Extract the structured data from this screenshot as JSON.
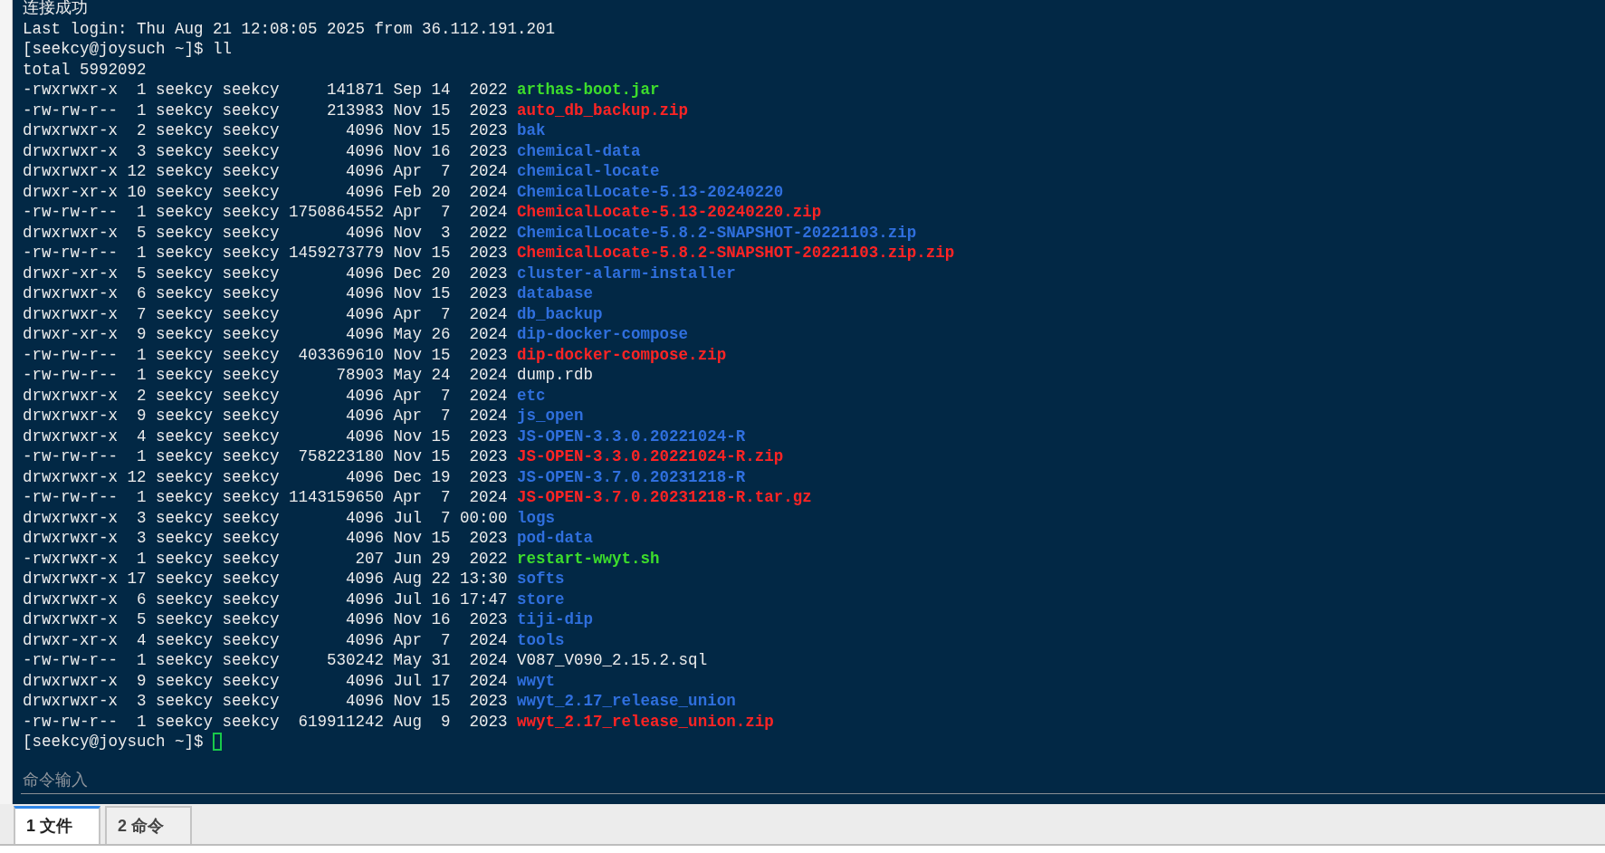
{
  "terminal": {
    "lines": [
      {
        "kind": "text",
        "text": "连接成功"
      },
      {
        "kind": "text",
        "text": "Last login: Thu Aug 21 12:08:05 2025 from 36.112.191.201"
      },
      {
        "kind": "text",
        "text": "[seekcy@joysuch ~]$ ll"
      },
      {
        "kind": "text",
        "text": "total 5992092"
      },
      {
        "kind": "entry",
        "info": "-rwxrwxr-x  1 seekcy seekcy     141871 Sep 14  2022",
        "name": "arthas-boot.jar",
        "color": "#3ddc2c",
        "bold": true
      },
      {
        "kind": "entry",
        "info": "-rw-rw-r--  1 seekcy seekcy     213983 Nov 15  2023",
        "name": "auto_db_backup.zip",
        "color": "#ff2424",
        "bold": true
      },
      {
        "kind": "entry",
        "info": "drwxrwxr-x  2 seekcy seekcy       4096 Nov 15  2023",
        "name": "bak",
        "color": "#2f6fdd",
        "bold": true
      },
      {
        "kind": "entry",
        "info": "drwxrwxr-x  3 seekcy seekcy       4096 Nov 16  2023",
        "name": "chemical-data",
        "color": "#2f6fdd",
        "bold": true
      },
      {
        "kind": "entry",
        "info": "drwxrwxr-x 12 seekcy seekcy       4096 Apr  7  2024",
        "name": "chemical-locate",
        "color": "#2f6fdd",
        "bold": true
      },
      {
        "kind": "entry",
        "info": "drwxr-xr-x 10 seekcy seekcy       4096 Feb 20  2024",
        "name": "ChemicalLocate-5.13-20240220",
        "color": "#2f6fdd",
        "bold": true
      },
      {
        "kind": "entry",
        "info": "-rw-rw-r--  1 seekcy seekcy 1750864552 Apr  7  2024",
        "name": "ChemicalLocate-5.13-20240220.zip",
        "color": "#ff2424",
        "bold": true
      },
      {
        "kind": "entry",
        "info": "drwxrwxr-x  5 seekcy seekcy       4096 Nov  3  2022",
        "name": "ChemicalLocate-5.8.2-SNAPSHOT-20221103.zip",
        "color": "#2f6fdd",
        "bold": true
      },
      {
        "kind": "entry",
        "info": "-rw-rw-r--  1 seekcy seekcy 1459273779 Nov 15  2023",
        "name": "ChemicalLocate-5.8.2-SNAPSHOT-20221103.zip.zip",
        "color": "#ff2424",
        "bold": true
      },
      {
        "kind": "entry",
        "info": "drwxr-xr-x  5 seekcy seekcy       4096 Dec 20  2023",
        "name": "cluster-alarm-installer",
        "color": "#2f6fdd",
        "bold": true
      },
      {
        "kind": "entry",
        "info": "drwxrwxr-x  6 seekcy seekcy       4096 Nov 15  2023",
        "name": "database",
        "color": "#2f6fdd",
        "bold": true
      },
      {
        "kind": "entry",
        "info": "drwxrwxr-x  7 seekcy seekcy       4096 Apr  7  2024",
        "name": "db_backup",
        "color": "#2f6fdd",
        "bold": true
      },
      {
        "kind": "entry",
        "info": "drwxr-xr-x  9 seekcy seekcy       4096 May 26  2024",
        "name": "dip-docker-compose",
        "color": "#2f6fdd",
        "bold": true
      },
      {
        "kind": "entry",
        "info": "-rw-rw-r--  1 seekcy seekcy  403369610 Nov 15  2023",
        "name": "dip-docker-compose.zip",
        "color": "#ff2424",
        "bold": true
      },
      {
        "kind": "entry",
        "info": "-rw-rw-r--  1 seekcy seekcy      78903 May 24  2024",
        "name": "dump.rdb",
        "color": "#ececec",
        "bold": false
      },
      {
        "kind": "entry",
        "info": "drwxrwxr-x  2 seekcy seekcy       4096 Apr  7  2024",
        "name": "etc",
        "color": "#2f6fdd",
        "bold": true
      },
      {
        "kind": "entry",
        "info": "drwxrwxr-x  9 seekcy seekcy       4096 Apr  7  2024",
        "name": "js_open",
        "color": "#2f6fdd",
        "bold": true
      },
      {
        "kind": "entry",
        "info": "drwxrwxr-x  4 seekcy seekcy       4096 Nov 15  2023",
        "name": "JS-OPEN-3.3.0.20221024-R",
        "color": "#2f6fdd",
        "bold": true
      },
      {
        "kind": "entry",
        "info": "-rw-rw-r--  1 seekcy seekcy  758223180 Nov 15  2023",
        "name": "JS-OPEN-3.3.0.20221024-R.zip",
        "color": "#ff2424",
        "bold": true
      },
      {
        "kind": "entry",
        "info": "drwxrwxr-x 12 seekcy seekcy       4096 Dec 19  2023",
        "name": "JS-OPEN-3.7.0.20231218-R",
        "color": "#2f6fdd",
        "bold": true
      },
      {
        "kind": "entry",
        "info": "-rw-rw-r--  1 seekcy seekcy 1143159650 Apr  7  2024",
        "name": "JS-OPEN-3.7.0.20231218-R.tar.gz",
        "color": "#ff2424",
        "bold": true
      },
      {
        "kind": "entry",
        "info": "drwxrwxr-x  3 seekcy seekcy       4096 Jul  7 00:00",
        "name": "logs",
        "color": "#2f6fdd",
        "bold": true
      },
      {
        "kind": "entry",
        "info": "drwxrwxr-x  3 seekcy seekcy       4096 Nov 15  2023",
        "name": "pod-data",
        "color": "#2f6fdd",
        "bold": true
      },
      {
        "kind": "entry",
        "info": "-rwxrwxr-x  1 seekcy seekcy        207 Jun 29  2022",
        "name": "restart-wwyt.sh",
        "color": "#3ddc2c",
        "bold": true
      },
      {
        "kind": "entry",
        "info": "drwxrwxr-x 17 seekcy seekcy       4096 Aug 22 13:30",
        "name": "softs",
        "color": "#2f6fdd",
        "bold": true
      },
      {
        "kind": "entry",
        "info": "drwxrwxr-x  6 seekcy seekcy       4096 Jul 16 17:47",
        "name": "store",
        "color": "#2f6fdd",
        "bold": true
      },
      {
        "kind": "entry",
        "info": "drwxrwxr-x  5 seekcy seekcy       4096 Nov 16  2023",
        "name": "tiji-dip",
        "color": "#2f6fdd",
        "bold": true
      },
      {
        "kind": "entry",
        "info": "drwxr-xr-x  4 seekcy seekcy       4096 Apr  7  2024",
        "name": "tools",
        "color": "#2f6fdd",
        "bold": true
      },
      {
        "kind": "entry",
        "info": "-rw-rw-r--  1 seekcy seekcy     530242 May 31  2024",
        "name": "V087_V090_2.15.2.sql",
        "color": "#ececec",
        "bold": false
      },
      {
        "kind": "entry",
        "info": "drwxrwxr-x  9 seekcy seekcy       4096 Jul 17  2024",
        "name": "wwyt",
        "color": "#2f6fdd",
        "bold": true
      },
      {
        "kind": "entry",
        "info": "drwxrwxr-x  3 seekcy seekcy       4096 Nov 15  2023",
        "name": "wwyt_2.17_release_union",
        "color": "#2f6fdd",
        "bold": true
      },
      {
        "kind": "entry",
        "info": "-rw-rw-r--  1 seekcy seekcy  619911242 Aug  9  2023",
        "name": "wwyt_2.17_release_union.zip",
        "color": "#ff2424",
        "bold": true
      },
      {
        "kind": "prompt",
        "text": "[seekcy@joysuch ~]$"
      }
    ],
    "command_input": {
      "placeholder": "命令输入"
    }
  },
  "tabs": [
    {
      "label": "1 文件",
      "selected": true
    },
    {
      "label": "2 命令",
      "selected": false
    }
  ]
}
